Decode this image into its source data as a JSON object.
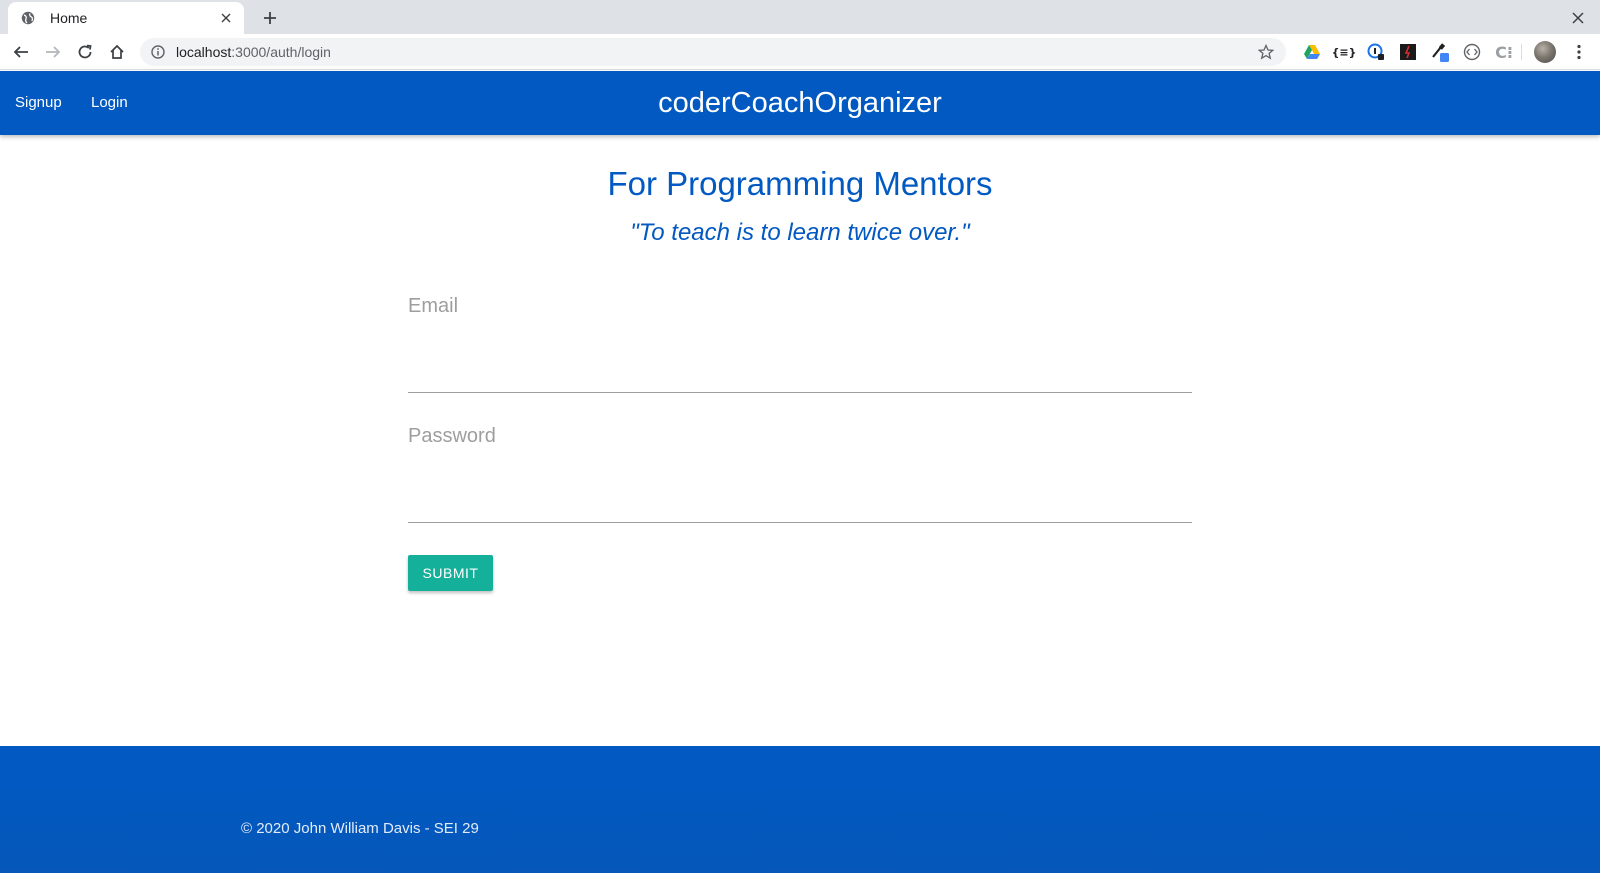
{
  "browser": {
    "tab_title": "Home",
    "url_host": "localhost",
    "url_rest": ":3000/auth/login",
    "extensions": [
      "google-drive-icon",
      "json-viewer-icon",
      "password-manager-icon",
      "dark-extension-icon",
      "color-picker-icon",
      "code-extension-icon",
      "css-extension-icon"
    ]
  },
  "nav": {
    "signup": "Signup",
    "login": "Login",
    "brand": "coderCoachOrganizer"
  },
  "main": {
    "heading": "For Programming Mentors",
    "quote": "\"To teach is to learn twice over.\""
  },
  "form": {
    "email_label": "Email",
    "email_value": "",
    "password_label": "Password",
    "password_value": "",
    "submit_label": "SUBMIT"
  },
  "footer": {
    "copyright": "© 2020 John William Davis - SEI 29"
  },
  "colors": {
    "primary": "#0159c1",
    "submit": "#14b09a"
  }
}
